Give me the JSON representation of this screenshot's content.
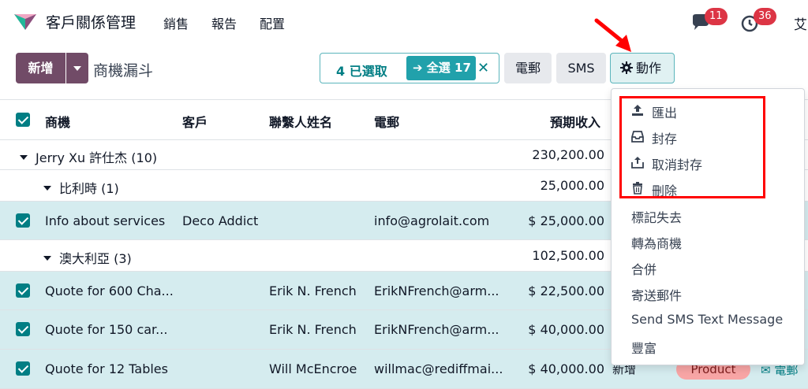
{
  "app": {
    "title": "客戶關係管理",
    "menu": [
      "銷售",
      "報告",
      "配置"
    ],
    "notifications": {
      "messages": "11",
      "activities": "36"
    },
    "user_initial": "艾"
  },
  "toolbar": {
    "new_label": "新增",
    "breadcrumb": "商機漏斗",
    "selection_count": "4 已選取",
    "select_all": "全選 17",
    "email_label": "電郵",
    "sms_label": "SMS",
    "action_label": "動作"
  },
  "table": {
    "headers": [
      "商機",
      "客戶",
      "聯繫人姓名",
      "電郵",
      "預期收入"
    ],
    "groups": [
      {
        "label": "Jerry Xu 許仕杰 (10)",
        "total": "230,200.00"
      },
      {
        "label": "比利時 (1)",
        "total": "25,000.00"
      },
      {
        "label": "澳大利亞 (3)",
        "total": "102,500.00"
      }
    ],
    "rows": [
      {
        "name": "Info about services",
        "customer": "Deco Addict",
        "contact": "",
        "email": "info@agrolait.com",
        "revenue": "$ 25,000.00"
      },
      {
        "name": "Quote for 600 Cha...",
        "customer": "",
        "contact": "Erik N. French",
        "email": "ErikNFrench@arm...",
        "revenue": "$ 22,500.00"
      },
      {
        "name": "Quote for 150 car...",
        "customer": "",
        "contact": "Erik N. French",
        "email": "ErikNFrench@arm...",
        "revenue": "$ 40,000.00"
      },
      {
        "name": "Quote for 12 Tables",
        "customer": "",
        "contact": "Will McEncroe",
        "email": "willmac@rediffmai...",
        "revenue": "$ 40,000.00"
      }
    ],
    "last_row_stage": "新增",
    "last_row_tag": "Product",
    "last_row_mail": "電郵"
  },
  "action_menu": {
    "items": [
      {
        "label": "匯出",
        "icon": "upload-icon"
      },
      {
        "label": "封存",
        "icon": "inbox-icon"
      },
      {
        "label": "取消封存",
        "icon": "unarchive-icon"
      },
      {
        "label": "刪除",
        "icon": "trash-icon"
      },
      {
        "label": "標記失去"
      },
      {
        "label": "轉為商機"
      },
      {
        "label": "合併"
      },
      {
        "label": "寄送郵件"
      },
      {
        "label": "Send SMS Text Message"
      },
      {
        "label": "豐富"
      }
    ]
  },
  "colors": {
    "brand": "#714b67",
    "accent": "#017e84",
    "selected_row": "#d5ecef",
    "annotation": "#ff0000"
  }
}
